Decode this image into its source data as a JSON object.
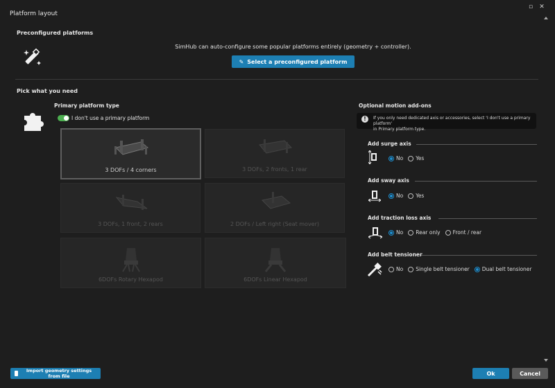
{
  "window": {
    "title": "Platform layout"
  },
  "preconfigured": {
    "title": "Preconfigured platforms",
    "description": "SimHub can auto-configure some popular platforms entirely (geometry + controller).",
    "button_label": "Select a preconfigured platform"
  },
  "pick": {
    "title": "Pick what you need",
    "primary_title": "Primary platform type",
    "toggle_label": "I don't use a primary platform",
    "tiles": [
      {
        "label": "3 DOFs / 4 corners",
        "selected": true
      },
      {
        "label": "3 DOFs, 2 fronts, 1 rear",
        "selected": false
      },
      {
        "label": "3 DOFs, 1 front, 2 rears",
        "selected": false
      },
      {
        "label": "2 DOFs / Left right (Seat mover)",
        "selected": false
      },
      {
        "label": "6DOFs Rotary Hexapod",
        "selected": false
      },
      {
        "label": "6DOFs Linear Hexapod",
        "selected": false
      }
    ]
  },
  "addons": {
    "title": "Optional motion add-ons",
    "info_line1": "If you only need dedicated axis or accessories, select 'I don't use a primary platform'",
    "info_line2": "in Primary platform type.",
    "groups": [
      {
        "title": "Add surge axis",
        "options": [
          "No",
          "Yes"
        ],
        "selected": 0
      },
      {
        "title": "Add sway axis",
        "options": [
          "No",
          "Yes"
        ],
        "selected": 0
      },
      {
        "title": "Add traction loss axis",
        "options": [
          "No",
          "Rear only",
          "Front / rear"
        ],
        "selected": 0
      },
      {
        "title": "Add belt tensioner",
        "options": [
          "No",
          "Single belt tensioner",
          "Dual belt tensioner"
        ],
        "selected": 2
      }
    ]
  },
  "footer": {
    "import_label": "Import geometry settings from file",
    "ok_label": "Ok",
    "cancel_label": "Cancel"
  }
}
